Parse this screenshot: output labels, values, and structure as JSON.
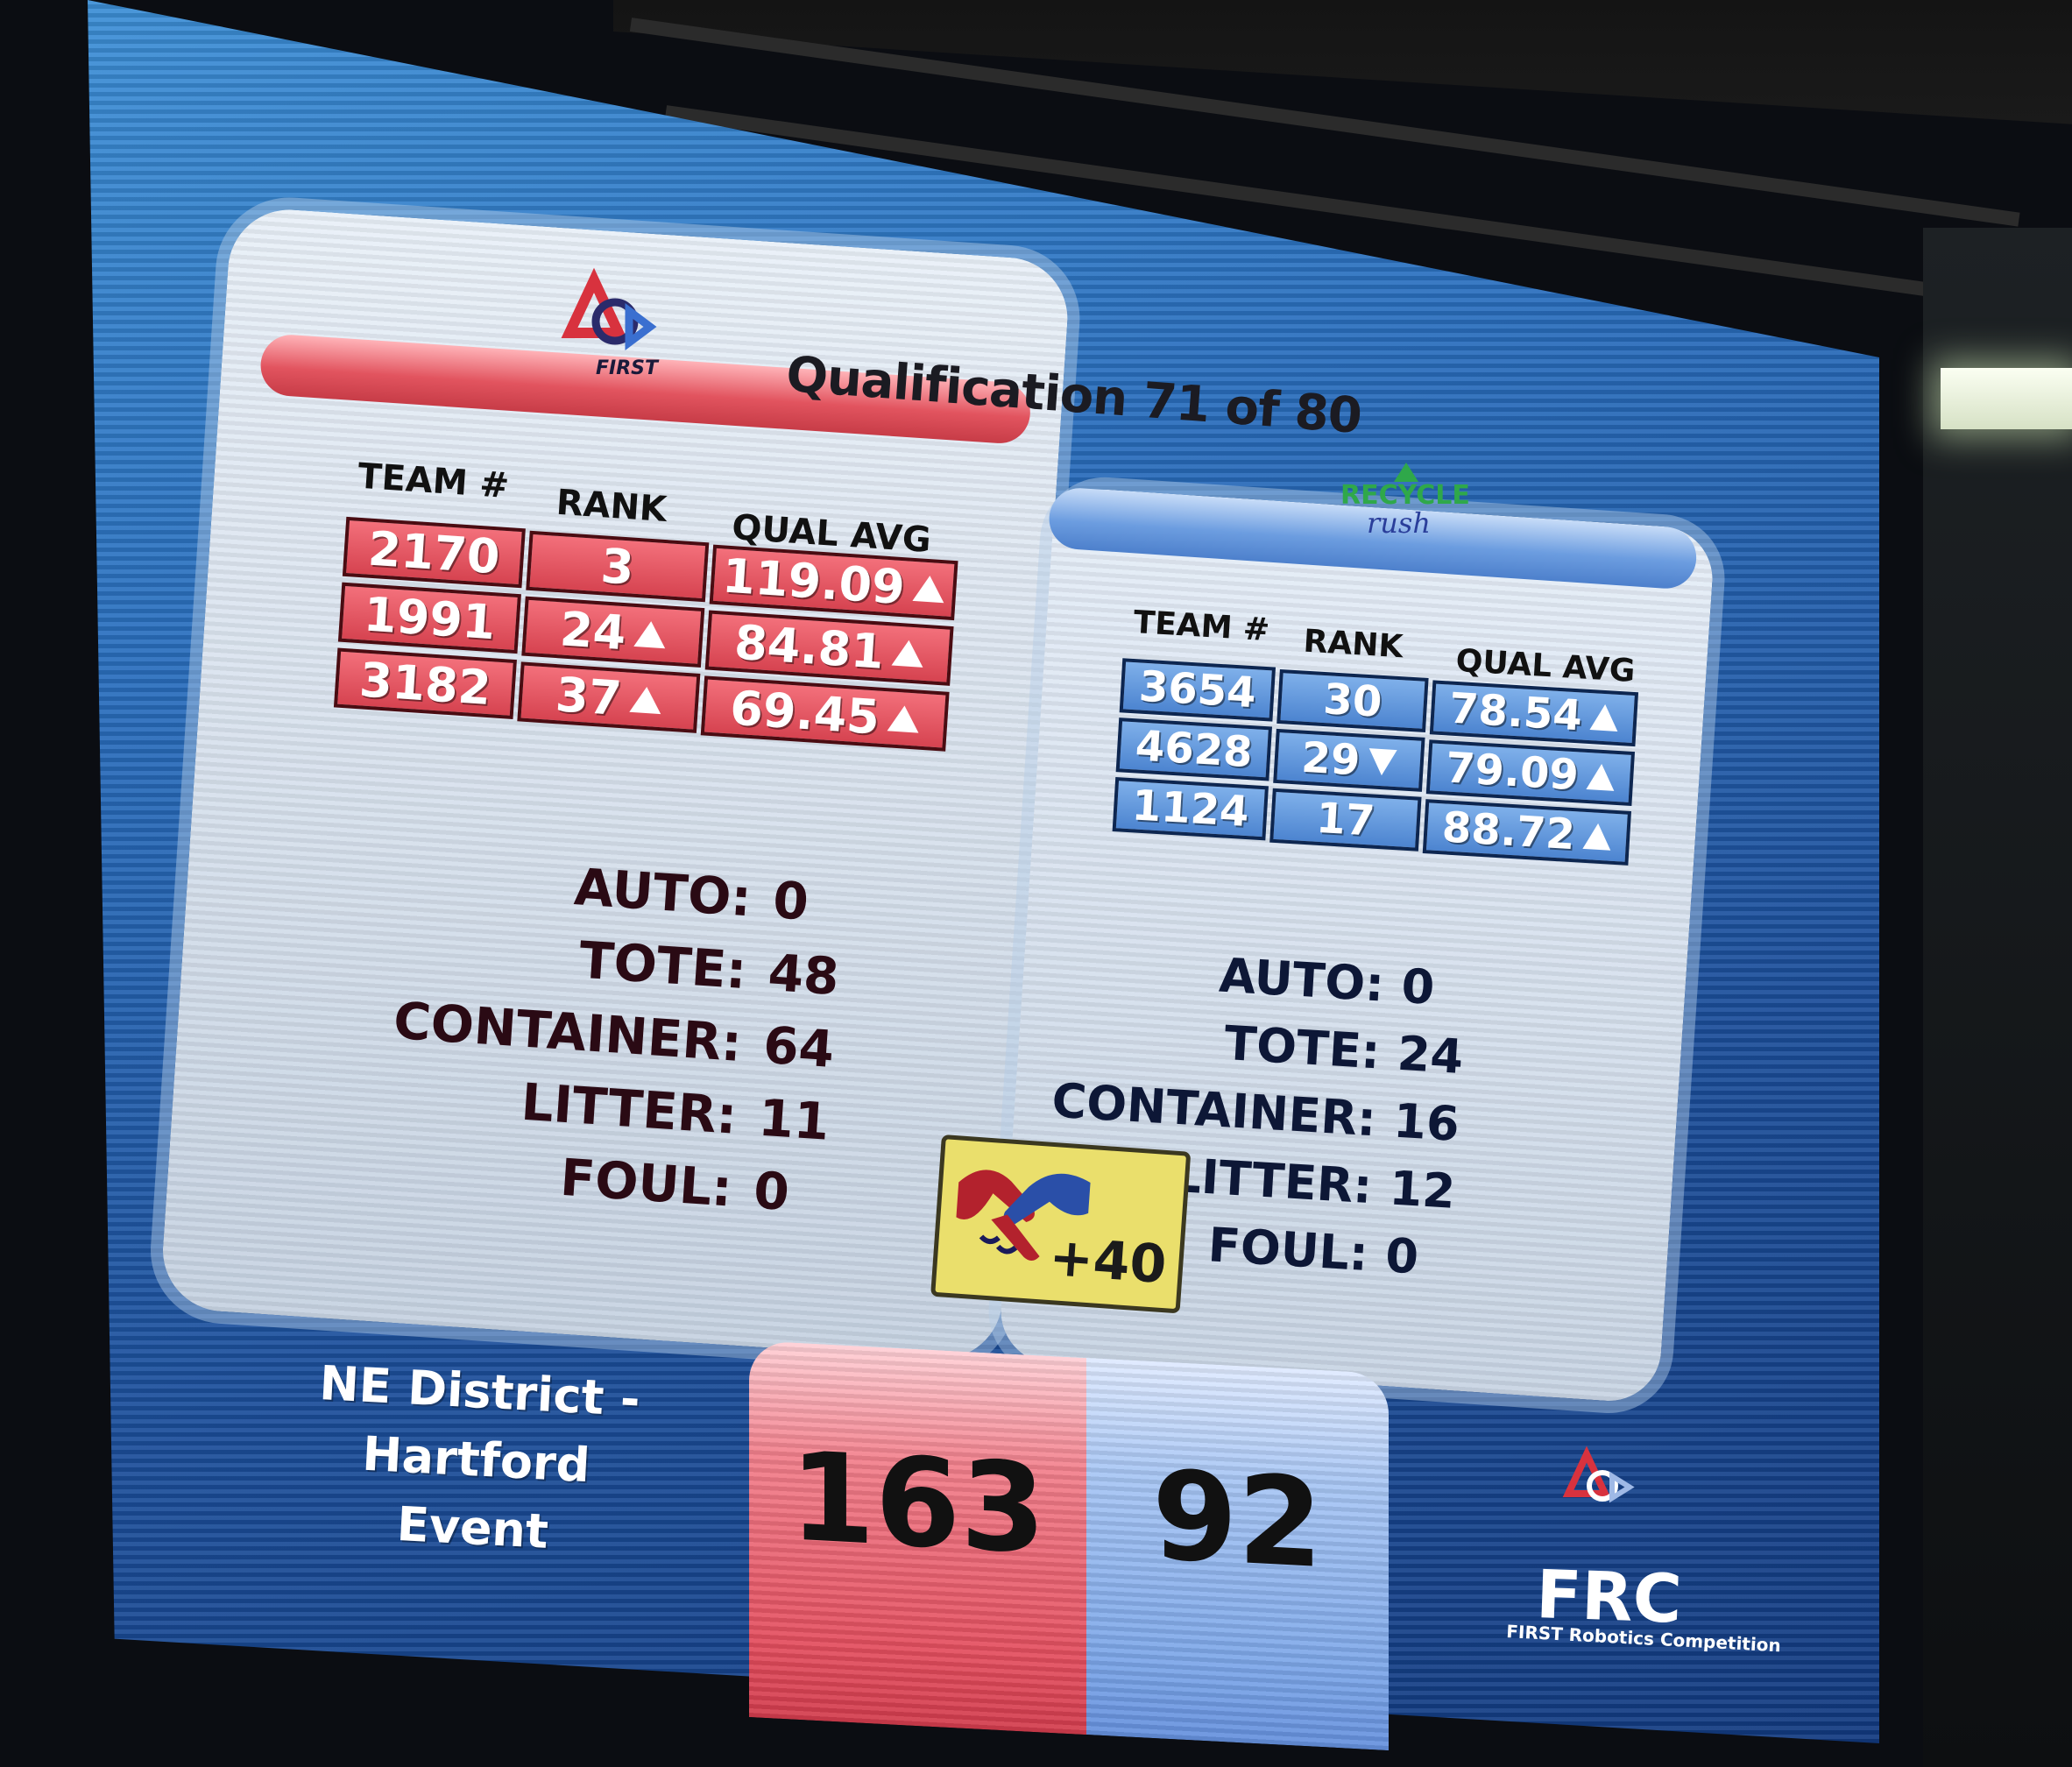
{
  "title": "Qualification 71 of 80",
  "red": {
    "headers": {
      "team": "TEAM #",
      "rank": "RANK",
      "avg": "QUAL AVG"
    },
    "rows": [
      {
        "team": "2170",
        "rank": "3",
        "rank_trend": "",
        "avg": "119.09",
        "avg_trend": "up"
      },
      {
        "team": "1991",
        "rank": "24",
        "rank_trend": "up",
        "avg": "84.81",
        "avg_trend": "up"
      },
      {
        "team": "3182",
        "rank": "37",
        "rank_trend": "up",
        "avg": "69.45",
        "avg_trend": "up"
      }
    ],
    "stats": [
      {
        "label": "AUTO:",
        "value": "0"
      },
      {
        "label": "TOTE:",
        "value": "48"
      },
      {
        "label": "CONTAINER:",
        "value": "64"
      },
      {
        "label": "LITTER:",
        "value": "11"
      },
      {
        "label": "FOUL:",
        "value": "0"
      }
    ],
    "score": "163"
  },
  "blue": {
    "headers": {
      "team": "TEAM #",
      "rank": "RANK",
      "avg": "QUAL AVG"
    },
    "rows": [
      {
        "team": "3654",
        "rank": "30",
        "rank_trend": "",
        "avg": "78.54",
        "avg_trend": "up"
      },
      {
        "team": "4628",
        "rank": "29",
        "rank_trend": "down",
        "avg": "79.09",
        "avg_trend": "up"
      },
      {
        "team": "1124",
        "rank": "17",
        "rank_trend": "",
        "avg": "88.72",
        "avg_trend": "up"
      }
    ],
    "stats": [
      {
        "label": "AUTO:",
        "value": "0"
      },
      {
        "label": "TOTE:",
        "value": "24"
      },
      {
        "label": "CONTAINER:",
        "value": "16"
      },
      {
        "label": "LITTER:",
        "value": "12"
      },
      {
        "label": "FOUL:",
        "value": "0"
      }
    ],
    "score": "92"
  },
  "coopertition": "+40",
  "event": {
    "line1": "NE District - Hartford",
    "line2": "Event"
  },
  "logos": {
    "first": "FIRST",
    "recycle_line1": "RECYCLE",
    "recycle_line2": "rush",
    "frc": "FRC",
    "frc_sub": "FIRST Robotics Competition"
  },
  "colors": {
    "red": "#e04b59",
    "blue": "#5d8fdb",
    "screen": "#2a6fbe",
    "coop": "#eadf6c"
  }
}
